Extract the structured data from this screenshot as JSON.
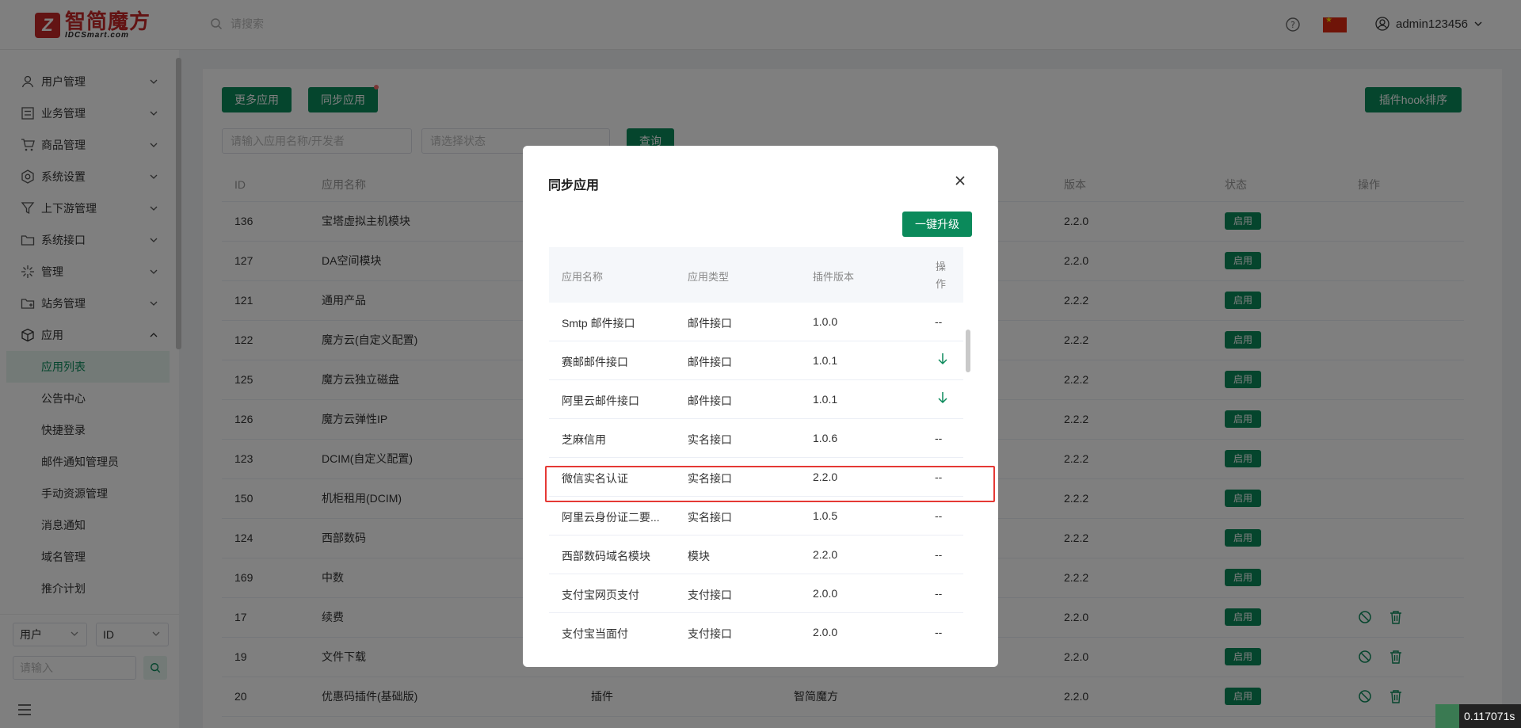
{
  "header": {
    "logo_cn": "智简魔方",
    "logo_en": "IDCSmart.com",
    "search_placeholder": "请搜索",
    "username": "admin123456",
    "icons": [
      "search-icon",
      "help-icon",
      "china-flag-icon",
      "user-icon",
      "chevron-down-icon"
    ]
  },
  "sidebar": {
    "items": [
      {
        "label": "用户管理",
        "icon": "user-icon"
      },
      {
        "label": "业务管理",
        "icon": "list-icon"
      },
      {
        "label": "商品管理",
        "icon": "cart-icon"
      },
      {
        "label": "系统设置",
        "icon": "gear-icon"
      },
      {
        "label": "上下游管理",
        "icon": "filter-icon"
      },
      {
        "label": "系统接口",
        "icon": "folder-icon"
      },
      {
        "label": "管理",
        "icon": "sparkle-icon"
      },
      {
        "label": "站务管理",
        "icon": "folder-plus-icon"
      },
      {
        "label": "应用",
        "icon": "box-icon"
      }
    ],
    "sub_items": [
      "应用列表",
      "公告中心",
      "快捷登录",
      "邮件通知管理员",
      "手动资源管理",
      "消息通知",
      "域名管理",
      "推介计划"
    ],
    "active_sub": "应用列表",
    "filter_type": "用户",
    "filter_field": "ID",
    "filter_placeholder": "请输入"
  },
  "main": {
    "more_apps": "更多应用",
    "sync_apps": "同步应用",
    "hook_sort": "插件hook排序",
    "name_placeholder": "请输入应用名称/开发者",
    "status_placeholder": "请选择状态",
    "query": "查询",
    "columns": [
      "ID",
      "应用名称",
      "",
      "",
      "版本",
      "状态",
      "操作"
    ],
    "rows": [
      {
        "id": "136",
        "name": "宝塔虚拟主机模块",
        "type": "",
        "dev": "",
        "version": "2.2.0",
        "status": "启用",
        "ops": false
      },
      {
        "id": "127",
        "name": "DA空间模块",
        "type": "",
        "dev": "",
        "version": "2.2.0",
        "status": "启用",
        "ops": false
      },
      {
        "id": "121",
        "name": "通用产品",
        "type": "",
        "dev": "",
        "version": "2.2.2",
        "status": "启用",
        "ops": false
      },
      {
        "id": "122",
        "name": "魔方云(自定义配置)",
        "type": "",
        "dev": "",
        "version": "2.2.2",
        "status": "启用",
        "ops": false
      },
      {
        "id": "125",
        "name": "魔方云独立磁盘",
        "type": "",
        "dev": "",
        "version": "2.2.2",
        "status": "启用",
        "ops": false
      },
      {
        "id": "126",
        "name": "魔方云弹性IP",
        "type": "",
        "dev": "",
        "version": "2.2.2",
        "status": "启用",
        "ops": false
      },
      {
        "id": "123",
        "name": "DCIM(自定义配置)",
        "type": "",
        "dev": "",
        "version": "2.2.2",
        "status": "启用",
        "ops": false
      },
      {
        "id": "150",
        "name": "机柜租用(DCIM)",
        "type": "",
        "dev": "",
        "version": "2.2.2",
        "status": "启用",
        "ops": false
      },
      {
        "id": "124",
        "name": "西部数码",
        "type": "",
        "dev": "",
        "version": "2.2.2",
        "status": "启用",
        "ops": false
      },
      {
        "id": "169",
        "name": "中数",
        "type": "",
        "dev": "",
        "version": "2.2.2",
        "status": "启用",
        "ops": false
      },
      {
        "id": "17",
        "name": "续费",
        "type": "",
        "dev": "",
        "version": "2.2.0",
        "status": "启用",
        "ops": true
      },
      {
        "id": "19",
        "name": "文件下载",
        "type": "",
        "dev": "",
        "version": "2.2.0",
        "status": "启用",
        "ops": true
      },
      {
        "id": "20",
        "name": "优惠码插件(基础版)",
        "type": "插件",
        "dev": "智简魔方",
        "version": "2.2.0",
        "status": "启用",
        "ops": true
      }
    ]
  },
  "modal": {
    "title": "同步应用",
    "upgrade_all": "一键升级",
    "columns": [
      "应用名称",
      "应用类型",
      "插件版本",
      "操作"
    ],
    "rows": [
      {
        "name": "Smtp 邮件接口",
        "type": "邮件接口",
        "version": "1.0.0",
        "op": "--"
      },
      {
        "name": "赛邮邮件接口",
        "type": "邮件接口",
        "version": "1.0.1",
        "op": "download"
      },
      {
        "name": "阿里云邮件接口",
        "type": "邮件接口",
        "version": "1.0.1",
        "op": "download"
      },
      {
        "name": "芝麻信用",
        "type": "实名接口",
        "version": "1.0.6",
        "op": "--"
      },
      {
        "name": "微信实名认证",
        "type": "实名接口",
        "version": "2.2.0",
        "op": "--"
      },
      {
        "name": "阿里云身份证二要...",
        "type": "实名接口",
        "version": "1.0.5",
        "op": "--"
      },
      {
        "name": "西部数码域名模块",
        "type": "模块",
        "version": "2.2.0",
        "op": "--"
      },
      {
        "name": "支付宝网页支付",
        "type": "支付接口",
        "version": "2.0.0",
        "op": "--"
      },
      {
        "name": "支付宝当面付",
        "type": "支付接口",
        "version": "2.0.0",
        "op": "--"
      }
    ],
    "highlighted_row": "微信实名认证"
  },
  "timer": "0.117071s",
  "colors": {
    "brand": "#0b8a5b",
    "logo": "#c62828",
    "highlight": "#e53935"
  }
}
